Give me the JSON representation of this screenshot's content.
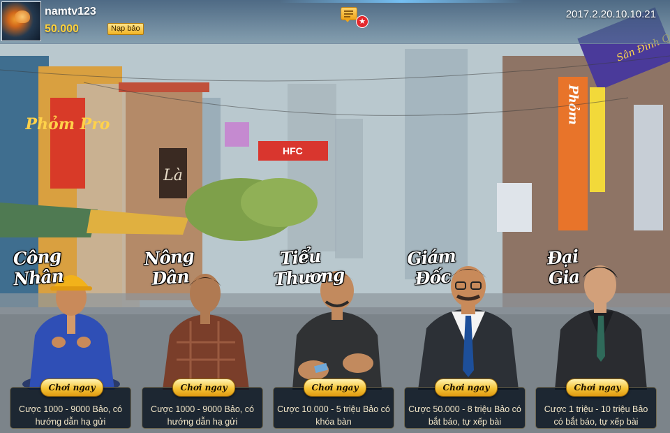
{
  "user": {
    "name": "namtv123",
    "balance": "50.000",
    "topup_label": "Nạp bảo"
  },
  "header": {
    "datetime": "2017.2.20.10.10.21",
    "notification_badge": "★"
  },
  "icons": {
    "avatar": "jellyfish-avatar",
    "chat": "chat-bubble-icon",
    "badge": "star-badge-icon"
  },
  "colors": {
    "accent_gold": "#f6c436",
    "balance_gold": "#ffd23c",
    "badge_red": "#e4282d"
  },
  "shop_signs": [
    "Phỏm Pro",
    "Là",
    "HFC",
    "Phỏm",
    "Sân Đình Quán"
  ],
  "games": [
    {
      "id": "cong-nhan",
      "title": "Công Nhân",
      "play_label": "Chơi ngay",
      "description": "Cược 1000 - 9000 Bảo, có hướng dẫn hạ gửi"
    },
    {
      "id": "nong-dan",
      "title": "Nông Dân",
      "play_label": "Chơi ngay",
      "description": "Cược 1000 - 9000 Bảo, có hướng dẫn hạ gửi"
    },
    {
      "id": "tieu-thuong",
      "title": "Tiểu Thương",
      "play_label": "Chơi ngay",
      "description": "Cược 10.000 - 5 triệu Bảo có khóa bàn"
    },
    {
      "id": "giam-doc",
      "title": "Giám Đốc",
      "play_label": "Chơi ngay",
      "description": "Cược 50.000 - 8 triệu Bảo có bắt báo, tự xếp bài"
    },
    {
      "id": "dai-gia",
      "title": "Đại Gia",
      "play_label": "Chơi ngay",
      "description": "Cược 1 triệu - 10 triệu Bảo có bắt báo, tự xếp bài"
    }
  ]
}
